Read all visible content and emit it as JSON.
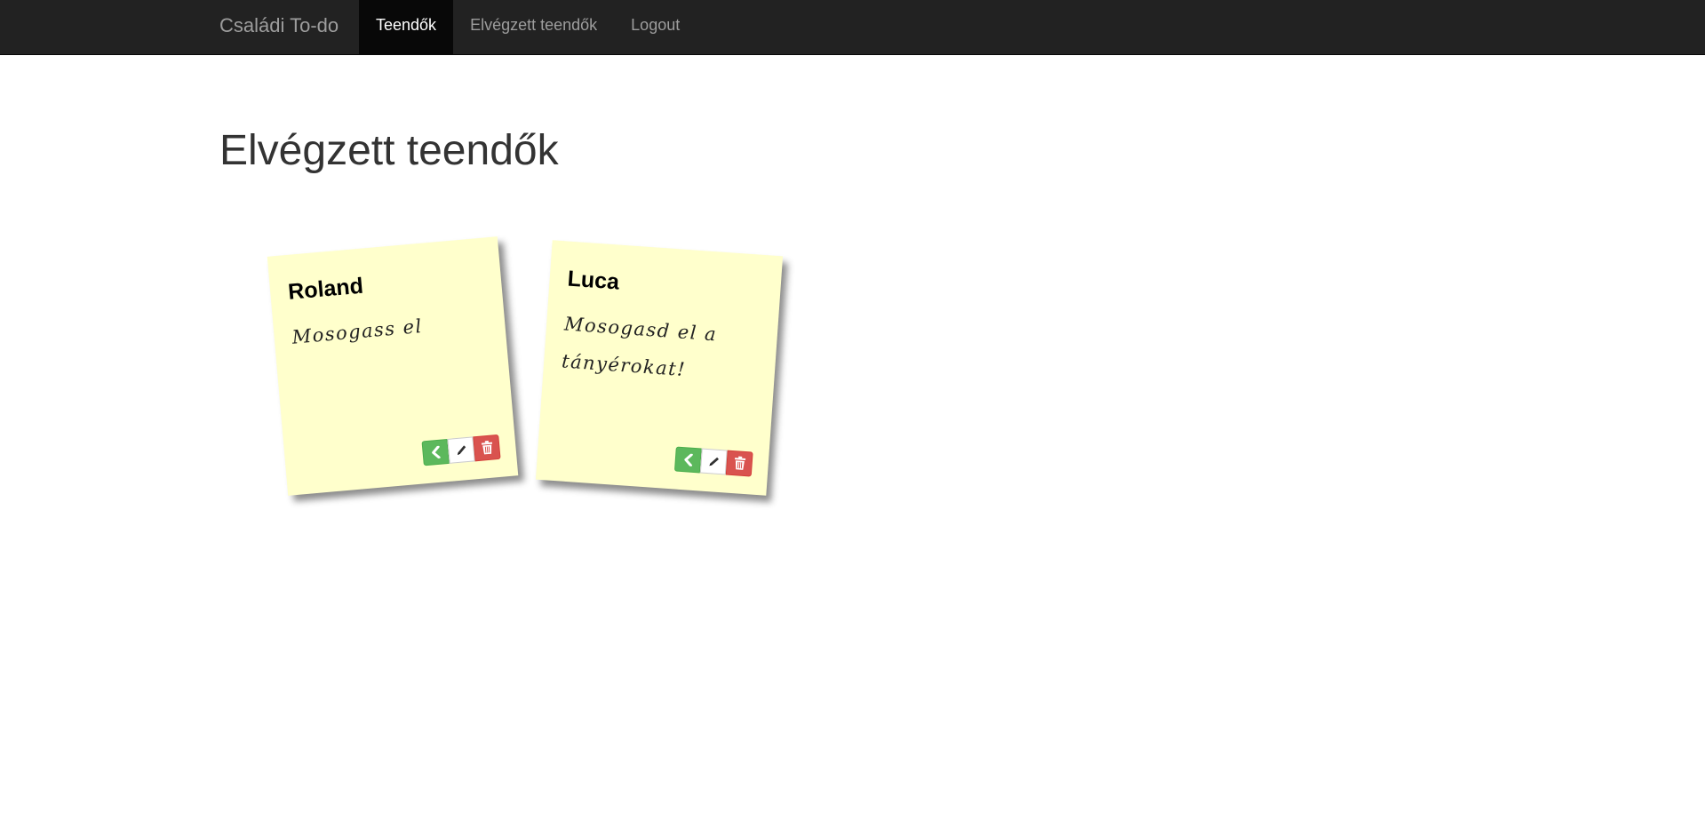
{
  "navbar": {
    "brand": "Családi To-do",
    "items": [
      {
        "label": "Teendők",
        "active": true
      },
      {
        "label": "Elvégzett teendők",
        "active": false
      },
      {
        "label": "Logout",
        "active": false
      }
    ]
  },
  "page": {
    "title": "Elvégzett teendők"
  },
  "notes": [
    {
      "name": "Roland",
      "text": "Mosogass el"
    },
    {
      "name": "Luca",
      "text": "Mosogasd el a tányérokat!"
    }
  ],
  "colors": {
    "navbar_bg": "#222222",
    "note_bg": "#ffffcc",
    "success": "#5cb85c",
    "danger": "#d9534f"
  },
  "icons": {
    "undo": "chevron-left-icon",
    "edit": "pencil-icon",
    "delete": "trash-icon"
  }
}
